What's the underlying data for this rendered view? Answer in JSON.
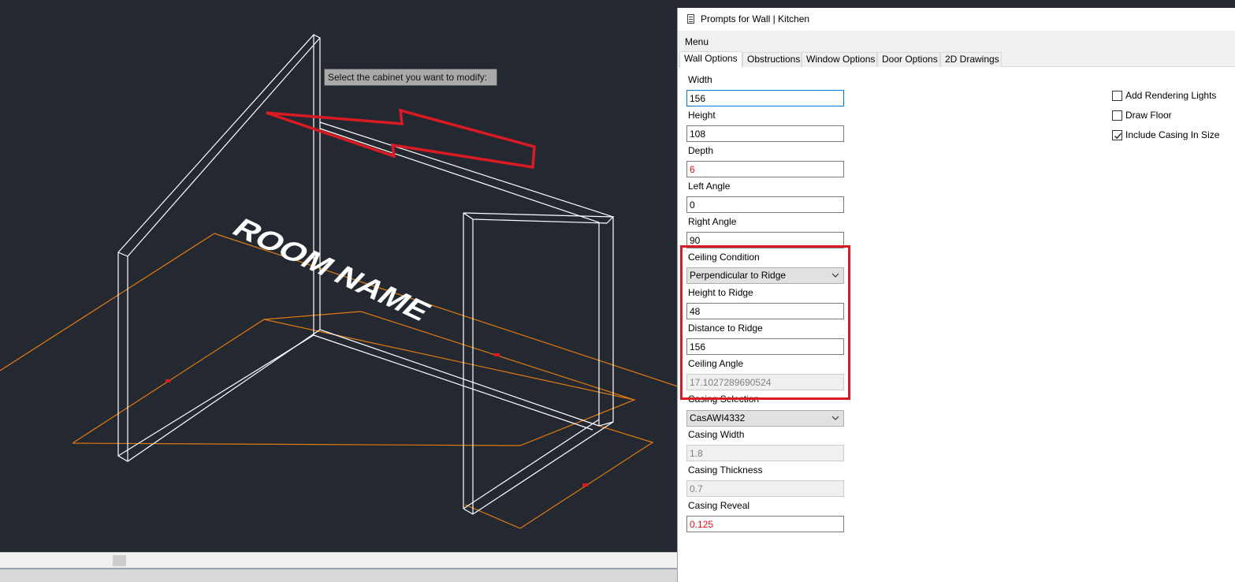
{
  "viewport": {
    "tooltip": "Select the cabinet you want to modify:",
    "room_label": "ROOM NAME"
  },
  "dialog": {
    "title": "Prompts for Wall | Kitchen",
    "menu_label": "Menu",
    "tabs": [
      {
        "label": "Wall Options",
        "active": true
      },
      {
        "label": "Obstructions",
        "active": false
      },
      {
        "label": "Window Options",
        "active": false
      },
      {
        "label": "Door Options",
        "active": false
      },
      {
        "label": "2D Drawings",
        "active": false
      }
    ],
    "fields": {
      "width": {
        "label": "Width",
        "value": "156"
      },
      "height": {
        "label": "Height",
        "value": "108"
      },
      "depth": {
        "label": "Depth",
        "value": "6"
      },
      "left_angle": {
        "label": "Left Angle",
        "value": "0"
      },
      "right_angle": {
        "label": "Right Angle",
        "value": "90"
      },
      "ceiling_condition": {
        "label": "Ceiling Condition",
        "value": "Perpendicular to Ridge"
      },
      "height_to_ridge": {
        "label": "Height to Ridge",
        "value": "48"
      },
      "distance_to_ridge": {
        "label": "Distance to Ridge",
        "value": "156"
      },
      "ceiling_angle": {
        "label": "Ceiling Angle",
        "value": "17.1027289690524"
      },
      "casing_selection": {
        "label": "Casing Selection",
        "value": "CasAWI4332"
      },
      "casing_width": {
        "label": "Casing Width",
        "value": "1.8"
      },
      "casing_thickness": {
        "label": "Casing Thickness",
        "value": "0.7"
      },
      "casing_reveal": {
        "label": "Casing Reveal",
        "value": "0.125"
      }
    },
    "checkboxes": {
      "add_rendering_lights": {
        "label": "Add Rendering Lights",
        "checked": false
      },
      "draw_floor": {
        "label": "Draw Floor",
        "checked": false
      },
      "include_casing_in_size": {
        "label": "Include Casing In Size",
        "checked": true
      }
    }
  },
  "colors": {
    "viewport_bg": "#232831",
    "wireframe": "#ffffff",
    "floor_lines": "#e07a10",
    "annotation_red": "#d91a22"
  }
}
